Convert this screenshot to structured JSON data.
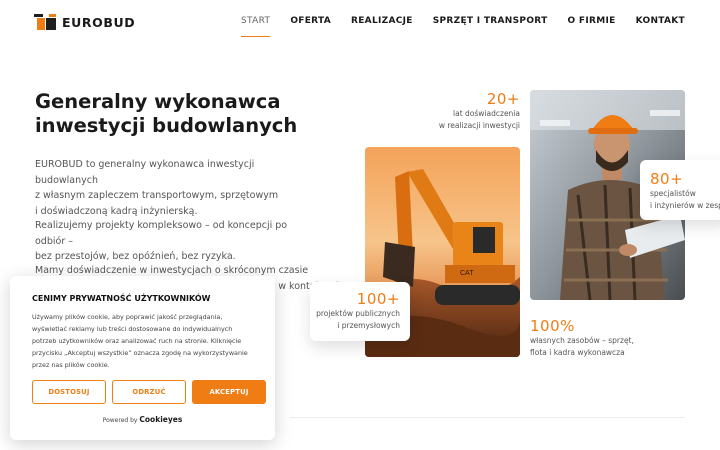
{
  "brand": {
    "name": "EUROBUD",
    "accent": "#f07c14",
    "dark": "#1e1e1e"
  },
  "nav": {
    "items": [
      {
        "label": "START",
        "active": true
      },
      {
        "label": "OFERTA"
      },
      {
        "label": "REALIZACJE"
      },
      {
        "label": "SPRZĘT I TRANSPORT"
      },
      {
        "label": "O FIRMIE"
      },
      {
        "label": "KONTAKT"
      }
    ]
  },
  "hero": {
    "title_line1": "Generalny wykonawca",
    "title_line2": "inwestycji budowlanych",
    "p1": [
      "EUROBUD to generalny wykonawca inwestycji budowlanych",
      "z własnym zapleczem transportowym, sprzętowym",
      "i doświadczoną kadrą inżynierską."
    ],
    "p2": [
      "Realizujemy projekty kompleksowo – od koncepcji po odbiór –",
      "bez przestojów, bez opóźnień, bez ryzyka."
    ],
    "p3": [
      "Mamy doświadczenie w inwestycjach o skróconym czasie",
      "realizacji i złożonych wymaganiach technicznych – w kontaktach"
    ]
  },
  "stats": {
    "years": {
      "value": "20+",
      "label1": "lat doświadczenia",
      "label2": "w realizacji inwestycji"
    },
    "projects": {
      "value": "100+",
      "label1": "projektów publicznych",
      "label2": "i przemysłowych"
    },
    "specialists": {
      "value": "80+",
      "label1": "specjalistów",
      "label2": "i inżynierów w zespole"
    },
    "own": {
      "value": "100%",
      "label1": "własnych zasobów – sprzęt,",
      "label2": "flota i kadra wykonawcza"
    }
  },
  "images": {
    "excavator": "excavator-photo",
    "worker": "engineer-photo"
  },
  "cookie": {
    "title": "CENIMY PRYWATNOŚĆ UŻYTKOWNIKÓW",
    "lines": [
      "Używamy plików cookie, aby poprawić jakość przeglądania,",
      "wyświetlać reklamy lub treści dostosowane do indywidualnych",
      "potrzeb użytkowników oraz analizować ruch na stronie. Kliknięcie",
      "przycisku „Akceptuj wszystkie” oznacza zgodę na wykorzystywanie",
      "przez nas plików cookie."
    ],
    "btn_customize": "DOSTOSUJ",
    "btn_reject": "ODRZUĆ",
    "btn_accept": "AKCEPTUJ",
    "powered_prefix": "Powered by",
    "powered_brand": "Cookieyes"
  }
}
